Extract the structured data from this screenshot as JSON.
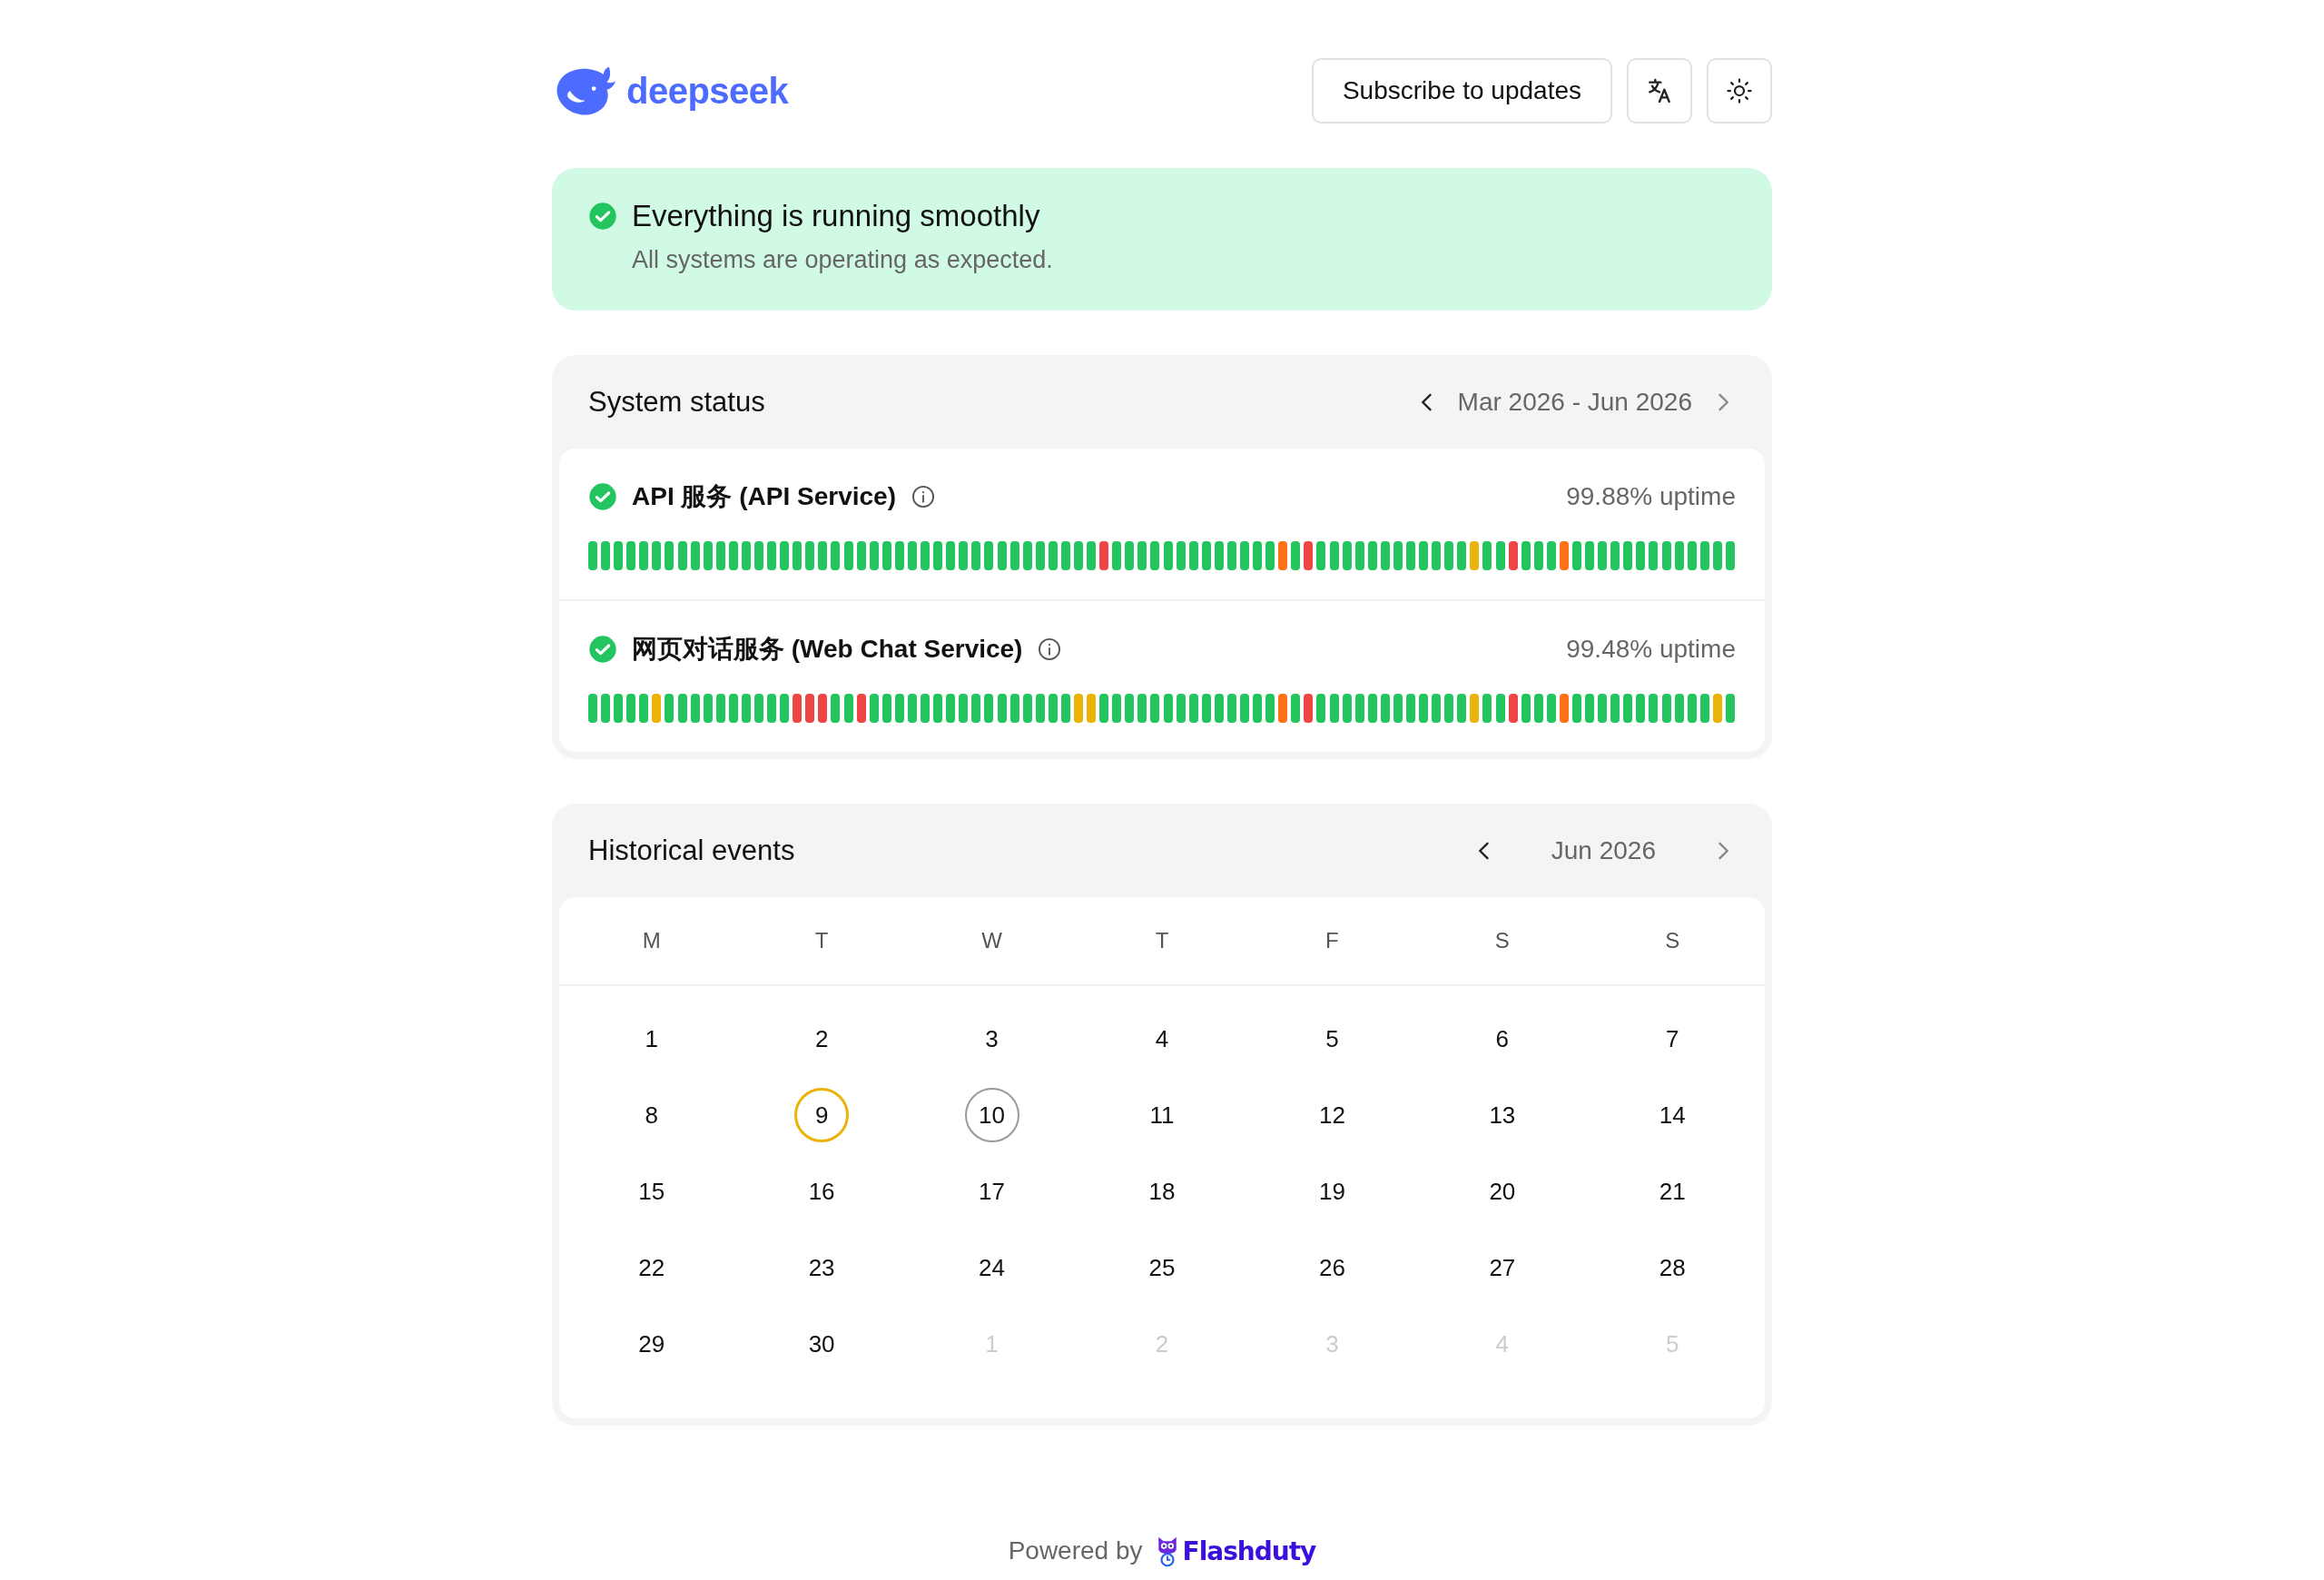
{
  "header": {
    "logo_text": "deepseek",
    "subscribe_button": "Subscribe to updates"
  },
  "banner": {
    "title": "Everything is running smoothly",
    "message": "All systems are operating as expected."
  },
  "system_status": {
    "title": "System status",
    "range": "Mar 2026 - Jun 2026",
    "prev_disabled": false,
    "next_disabled": true,
    "services": [
      {
        "name": "API 服务 (API Service)",
        "uptime": "99.88% uptime",
        "bars": [
          {
            "color": "#22c55e"
          },
          {
            "color": "#22c55e"
          },
          {
            "color": "#22c55e"
          },
          {
            "color": "#22c55e"
          },
          {
            "color": "#22c55e"
          },
          {
            "color": "#22c55e"
          },
          {
            "color": "#22c55e"
          },
          {
            "color": "#22c55e"
          },
          {
            "color": "#22c55e"
          },
          {
            "color": "#22c55e"
          },
          {
            "color": "#22c55e"
          },
          {
            "color": "#22c55e"
          },
          {
            "color": "#22c55e"
          },
          {
            "color": "#22c55e"
          },
          {
            "color": "#22c55e"
          },
          {
            "color": "#22c55e"
          },
          {
            "color": "#22c55e"
          },
          {
            "color": "#22c55e"
          },
          {
            "color": "#22c55e"
          },
          {
            "color": "#22c55e"
          },
          {
            "color": "#22c55e"
          },
          {
            "color": "#22c55e"
          },
          {
            "color": "#22c55e"
          },
          {
            "color": "#22c55e"
          },
          {
            "color": "#22c55e"
          },
          {
            "color": "#22c55e"
          },
          {
            "color": "#22c55e"
          },
          {
            "color": "#22c55e"
          },
          {
            "color": "#22c55e"
          },
          {
            "color": "#22c55e"
          },
          {
            "color": "#22c55e"
          },
          {
            "color": "#22c55e"
          },
          {
            "color": "#22c55e"
          },
          {
            "color": "#22c55e"
          },
          {
            "color": "#22c55e"
          },
          {
            "color": "#22c55e"
          },
          {
            "color": "#22c55e"
          },
          {
            "color": "#22c55e"
          },
          {
            "color": "#22c55e"
          },
          {
            "color": "#22c55e"
          },
          {
            "color": "#ef4444"
          },
          {
            "color": "#22c55e"
          },
          {
            "color": "#22c55e"
          },
          {
            "color": "#22c55e"
          },
          {
            "color": "#22c55e"
          },
          {
            "color": "#22c55e"
          },
          {
            "color": "#22c55e"
          },
          {
            "color": "#22c55e"
          },
          {
            "color": "#22c55e"
          },
          {
            "color": "#22c55e"
          },
          {
            "color": "#22c55e"
          },
          {
            "color": "#22c55e"
          },
          {
            "color": "#22c55e"
          },
          {
            "color": "#22c55e"
          },
          {
            "color": "#f97316"
          },
          {
            "color": "#22c55e"
          },
          {
            "color": "#ef4444"
          },
          {
            "color": "#22c55e"
          },
          {
            "color": "#22c55e"
          },
          {
            "color": "#22c55e"
          },
          {
            "color": "#22c55e"
          },
          {
            "color": "#22c55e"
          },
          {
            "color": "#22c55e"
          },
          {
            "color": "#22c55e"
          },
          {
            "color": "#22c55e"
          },
          {
            "color": "#22c55e"
          },
          {
            "color": "#22c55e"
          },
          {
            "color": "#22c55e"
          },
          {
            "color": "#22c55e"
          },
          {
            "color": "#eab308"
          },
          {
            "color": "#22c55e"
          },
          {
            "color": "#22c55e"
          },
          {
            "color": "#ef4444"
          },
          {
            "color": "#22c55e"
          },
          {
            "color": "#22c55e"
          },
          {
            "color": "#22c55e"
          },
          {
            "color": "#f97316"
          },
          {
            "color": "#22c55e"
          },
          {
            "color": "#22c55e"
          },
          {
            "color": "#22c55e"
          },
          {
            "color": "#22c55e"
          },
          {
            "color": "#22c55e"
          },
          {
            "color": "#22c55e"
          },
          {
            "color": "#22c55e"
          },
          {
            "color": "#22c55e"
          },
          {
            "color": "#22c55e"
          },
          {
            "color": "#22c55e"
          },
          {
            "color": "#22c55e"
          },
          {
            "color": "#22c55e"
          },
          {
            "color": "#22c55e"
          }
        ]
      },
      {
        "name": "网页对话服务 (Web Chat Service)",
        "uptime": "99.48% uptime",
        "bars": [
          {
            "color": "#22c55e"
          },
          {
            "color": "#22c55e"
          },
          {
            "color": "#22c55e"
          },
          {
            "color": "#22c55e"
          },
          {
            "color": "#22c55e"
          },
          {
            "color": "#eab308"
          },
          {
            "color": "#22c55e"
          },
          {
            "color": "#22c55e"
          },
          {
            "color": "#22c55e"
          },
          {
            "color": "#22c55e"
          },
          {
            "color": "#22c55e"
          },
          {
            "color": "#22c55e"
          },
          {
            "color": "#22c55e"
          },
          {
            "color": "#22c55e"
          },
          {
            "color": "#22c55e"
          },
          {
            "color": "#22c55e"
          },
          {
            "color": "#ef4444"
          },
          {
            "color": "#ef4444"
          },
          {
            "color": "#ef4444"
          },
          {
            "color": "#22c55e"
          },
          {
            "color": "#22c55e"
          },
          {
            "color": "#ef4444"
          },
          {
            "color": "#22c55e"
          },
          {
            "color": "#22c55e"
          },
          {
            "color": "#22c55e"
          },
          {
            "color": "#22c55e"
          },
          {
            "color": "#22c55e"
          },
          {
            "color": "#22c55e"
          },
          {
            "color": "#22c55e"
          },
          {
            "color": "#22c55e"
          },
          {
            "color": "#22c55e"
          },
          {
            "color": "#22c55e"
          },
          {
            "color": "#22c55e"
          },
          {
            "color": "#22c55e"
          },
          {
            "color": "#22c55e"
          },
          {
            "color": "#22c55e"
          },
          {
            "color": "#22c55e"
          },
          {
            "color": "#22c55e"
          },
          {
            "color": "#eab308"
          },
          {
            "color": "#eab308"
          },
          {
            "color": "#22c55e"
          },
          {
            "color": "#22c55e"
          },
          {
            "color": "#22c55e"
          },
          {
            "color": "#22c55e"
          },
          {
            "color": "#22c55e"
          },
          {
            "color": "#22c55e"
          },
          {
            "color": "#22c55e"
          },
          {
            "color": "#22c55e"
          },
          {
            "color": "#22c55e"
          },
          {
            "color": "#22c55e"
          },
          {
            "color": "#22c55e"
          },
          {
            "color": "#22c55e"
          },
          {
            "color": "#22c55e"
          },
          {
            "color": "#22c55e"
          },
          {
            "color": "#f97316"
          },
          {
            "color": "#22c55e"
          },
          {
            "color": "#ef4444"
          },
          {
            "color": "#22c55e"
          },
          {
            "color": "#22c55e"
          },
          {
            "color": "#22c55e"
          },
          {
            "color": "#22c55e"
          },
          {
            "color": "#22c55e"
          },
          {
            "color": "#22c55e"
          },
          {
            "color": "#22c55e"
          },
          {
            "color": "#22c55e"
          },
          {
            "color": "#22c55e"
          },
          {
            "color": "#22c55e"
          },
          {
            "color": "#22c55e"
          },
          {
            "color": "#22c55e"
          },
          {
            "color": "#eab308"
          },
          {
            "color": "#22c55e"
          },
          {
            "color": "#22c55e"
          },
          {
            "color": "#ef4444"
          },
          {
            "color": "#22c55e"
          },
          {
            "color": "#22c55e"
          },
          {
            "color": "#22c55e"
          },
          {
            "color": "#f97316"
          },
          {
            "color": "#22c55e"
          },
          {
            "color": "#22c55e"
          },
          {
            "color": "#22c55e"
          },
          {
            "color": "#22c55e"
          },
          {
            "color": "#22c55e"
          },
          {
            "color": "#22c55e"
          },
          {
            "color": "#22c55e"
          },
          {
            "color": "#22c55e"
          },
          {
            "color": "#22c55e"
          },
          {
            "color": "#22c55e"
          },
          {
            "color": "#22c55e"
          },
          {
            "color": "#eab308"
          },
          {
            "color": "#22c55e"
          }
        ]
      }
    ]
  },
  "historical_events": {
    "title": "Historical events",
    "month": "Jun 2026",
    "prev_disabled": false,
    "next_disabled": true,
    "weekdays": [
      "M",
      "T",
      "W",
      "T",
      "F",
      "S",
      "S"
    ],
    "days": [
      {
        "label": "1",
        "outside": false,
        "today": false
      },
      {
        "label": "2",
        "outside": false,
        "today": false
      },
      {
        "label": "3",
        "outside": false,
        "today": false
      },
      {
        "label": "4",
        "outside": false,
        "today": false
      },
      {
        "label": "5",
        "outside": false,
        "today": false
      },
      {
        "label": "6",
        "outside": false,
        "today": false
      },
      {
        "label": "7",
        "outside": false,
        "today": false
      },
      {
        "label": "8",
        "outside": false,
        "today": false
      },
      {
        "label": "9",
        "outside": false,
        "today": false,
        "color": "#eab308"
      },
      {
        "label": "10",
        "outside": false,
        "today": true
      },
      {
        "label": "11",
        "outside": false,
        "today": false
      },
      {
        "label": "12",
        "outside": false,
        "today": false
      },
      {
        "label": "13",
        "outside": false,
        "today": false
      },
      {
        "label": "14",
        "outside": false,
        "today": false
      },
      {
        "label": "15",
        "outside": false,
        "today": false
      },
      {
        "label": "16",
        "outside": false,
        "today": false
      },
      {
        "label": "17",
        "outside": false,
        "today": false
      },
      {
        "label": "18",
        "outside": false,
        "today": false
      },
      {
        "label": "19",
        "outside": false,
        "today": false
      },
      {
        "label": "20",
        "outside": false,
        "today": false
      },
      {
        "label": "21",
        "outside": false,
        "today": false
      },
      {
        "label": "22",
        "outside": false,
        "today": false
      },
      {
        "label": "23",
        "outside": false,
        "today": false
      },
      {
        "label": "24",
        "outside": false,
        "today": false
      },
      {
        "label": "25",
        "outside": false,
        "today": false
      },
      {
        "label": "26",
        "outside": false,
        "today": false
      },
      {
        "label": "27",
        "outside": false,
        "today": false
      },
      {
        "label": "28",
        "outside": false,
        "today": false
      },
      {
        "label": "29",
        "outside": false,
        "today": false
      },
      {
        "label": "30",
        "outside": false,
        "today": false
      },
      {
        "label": "1",
        "outside": true,
        "today": false
      },
      {
        "label": "2",
        "outside": true,
        "today": false
      },
      {
        "label": "3",
        "outside": true,
        "today": false
      },
      {
        "label": "4",
        "outside": true,
        "today": false
      },
      {
        "label": "5",
        "outside": true,
        "today": false
      }
    ]
  },
  "footer": {
    "powered_by": "Powered by",
    "brand": "Flashduty"
  }
}
